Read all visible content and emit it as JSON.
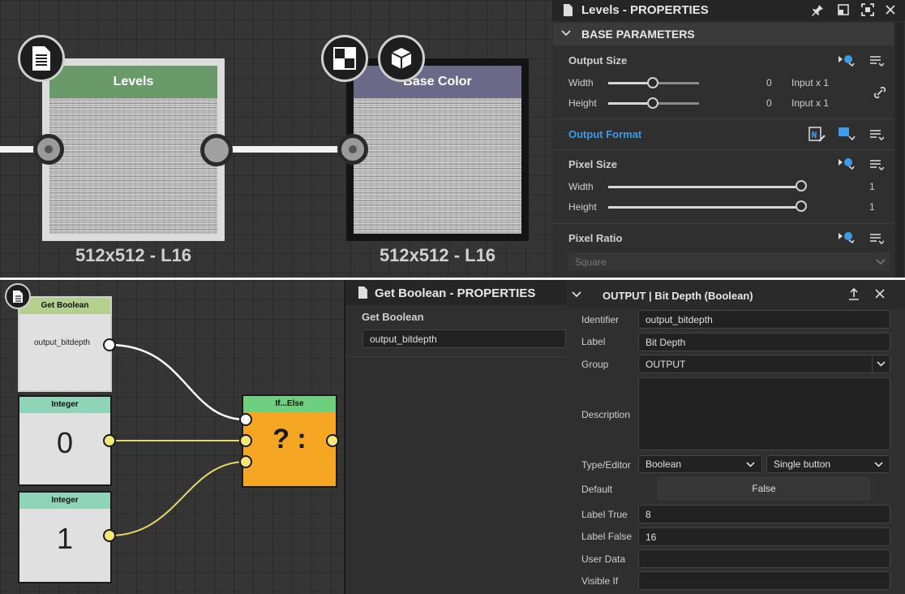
{
  "graph_top": {
    "nodes": [
      {
        "title": "Levels",
        "resolution": "512x512 - L16",
        "header_color": "#6a9a6a"
      },
      {
        "title": "Base Color",
        "resolution": "512x512 - L16",
        "header_color": "#6a6a88"
      }
    ]
  },
  "levels_panel": {
    "title": "Levels - PROPERTIES",
    "section": "BASE PARAMETERS",
    "output_size": {
      "label": "Output Size",
      "width_label": "Width",
      "width_value": "0",
      "width_unit": "Input x 1",
      "height_label": "Height",
      "height_value": "0",
      "height_unit": "Input x 1"
    },
    "output_format": {
      "label": "Output Format"
    },
    "pixel_size": {
      "label": "Pixel Size",
      "width_label": "Width",
      "width_value": "1",
      "height_label": "Height",
      "height_value": "1"
    },
    "pixel_ratio": {
      "label": "Pixel Ratio",
      "value": "Square"
    }
  },
  "graph_bottom": {
    "get_boolean": {
      "title": "Get Boolean",
      "output": "output_bitdepth"
    },
    "integer_0": {
      "title": "Integer",
      "value": "0"
    },
    "integer_1": {
      "title": "Integer",
      "value": "1"
    },
    "ifelse": {
      "title": "If...Else",
      "symbol": "? :"
    }
  },
  "getbool_panel": {
    "title": "Get Boolean - PROPERTIES",
    "section": "Get Boolean",
    "value": "output_bitdepth"
  },
  "output_panel": {
    "title": "OUTPUT | Bit Depth (Boolean)",
    "identifier_label": "Identifier",
    "identifier": "output_bitdepth",
    "label_label": "Label",
    "label": "Bit Depth",
    "group_label": "Group",
    "group": "OUTPUT",
    "description_label": "Description",
    "description": "",
    "type_label": "Type/Editor",
    "type": "Boolean",
    "editor": "Single button",
    "default_label": "Default",
    "default": "False",
    "label_true_label": "Label True",
    "label_true": "8",
    "label_false_label": "Label False",
    "label_false": "16",
    "user_data_label": "User Data",
    "user_data": "",
    "visible_if_label": "Visible If",
    "visible_if": ""
  },
  "colors": {
    "accent_blue": "#3d9be9",
    "ifelse_orange": "#f5a623",
    "integer_head": "#8fd4b8",
    "getbool_head": "#b5d08e"
  }
}
